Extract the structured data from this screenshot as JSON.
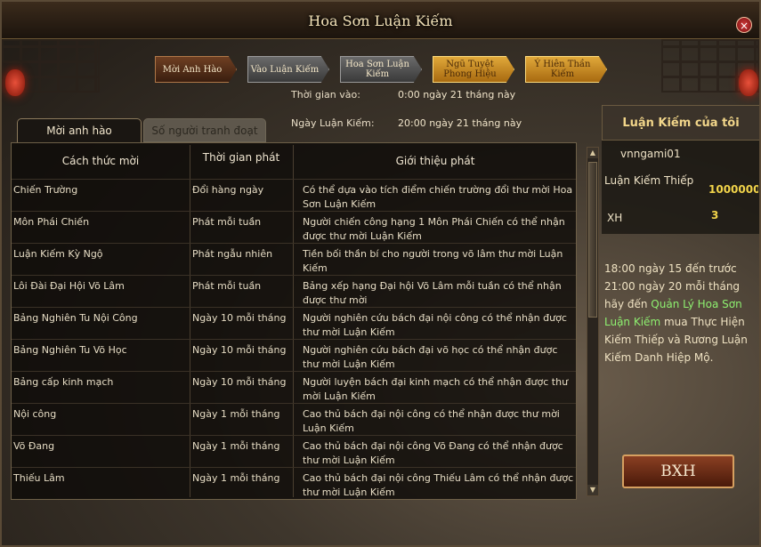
{
  "window": {
    "title": "Hoa Sơn Luận Kiếm",
    "close": "×"
  },
  "top_tabs": [
    {
      "label": "Mời Anh Hào"
    },
    {
      "label": "Vào Luận Kiếm"
    },
    {
      "label": "Hoa Sơn Luận Kiếm"
    },
    {
      "label": "Ngũ Tuyệt Phong Hiệu"
    },
    {
      "label": "Ý Hiên Thần Kiếm"
    }
  ],
  "info": {
    "time_in_label": "Thời gian vào:",
    "time_in_value": "0:00 ngày 21 tháng này",
    "day_label": "Ngày Luận Kiếm:",
    "day_value": "20:00 ngày 21 tháng này"
  },
  "left_tabs": {
    "active": "Mời anh hào",
    "inactive": "Số người tranh đoạt"
  },
  "table": {
    "headers": [
      "Cách thức mời",
      "Thời gian phát",
      "Giới thiệu phát"
    ],
    "rows": [
      {
        "method": "Chiến Trường",
        "time": "Đổi hàng ngày",
        "desc": "Có thể dựa vào tích điểm chiến trường đổi thư mời Hoa Sơn Luận Kiếm"
      },
      {
        "method": "Môn Phái Chiến",
        "time": "Phát mỗi tuần",
        "desc": "Người chiến công hạng 1 Môn Phái Chiến có thể nhận được thư mời Luận Kiếm"
      },
      {
        "method": "Luận Kiếm Kỳ Ngộ",
        "time": "Phát ngẫu nhiên",
        "desc": "Tiền bối thần bí cho người trong võ lâm thư mời Luận Kiếm"
      },
      {
        "method": "Lôi Đài Đại Hội Võ Lâm",
        "time": "Phát mỗi tuần",
        "desc": "Bảng xếp hạng Đại hội Võ Lâm mỗi tuần có thể nhận được thư mời"
      },
      {
        "method": "Bảng Nghiên Tu Nội Công",
        "time": "Ngày 10 mỗi tháng",
        "desc": "Người nghiên cứu bách đại nội công có thể nhận được thư mời Luận Kiếm"
      },
      {
        "method": "Bảng Nghiên Tu Võ Học",
        "time": "Ngày 10 mỗi tháng",
        "desc": "Người nghiên cứu bách đại võ học có thể nhận được thư mời Luận Kiếm"
      },
      {
        "method": "Bảng cấp kinh mạch",
        "time": "Ngày 10 mỗi tháng",
        "desc": "Người luyện bách đại kinh mạch có thể nhận được thư mời Luận Kiếm"
      },
      {
        "method": "Nội công",
        "time": "Ngày 1 mỗi tháng",
        "desc": "Cao thủ bách đại nội công có thể nhận được thư mời Luận Kiếm"
      },
      {
        "method": "Võ Đang",
        "time": "Ngày 1 mỗi tháng",
        "desc": "Cao thủ bách đại nội công Võ Đang có thể nhận được thư mời Luận Kiếm"
      },
      {
        "method": "Thiếu Lâm",
        "time": "Ngày 1 mỗi tháng",
        "desc": "Cao thủ bách đại nội công Thiếu Lâm có thể nhận được thư mời Luận Kiếm"
      }
    ]
  },
  "right_panel": {
    "heading": "Luận Kiếm của tôi",
    "username": "vnngami01",
    "ticket_label": "Luận Kiếm Thiếp",
    "ticket_value": "1000000",
    "rank_label": "XH",
    "rank_value": "3",
    "desc_part1": "18:00 ngày 15 đến trước 21:00 ngày 20 mỗi tháng hãy đến ",
    "desc_link": "Quản Lý Hoa Sơn Luận Kiếm",
    "desc_part2": " mua Thực Hiện Kiếm Thiếp và Rương Luận Kiếm Danh Hiệp Mộ.",
    "bxh_button": "BXH"
  },
  "colors": {
    "accent_gold": "#f2d44a",
    "link_green": "#8ef070",
    "heading_gold": "#f2d68a"
  }
}
